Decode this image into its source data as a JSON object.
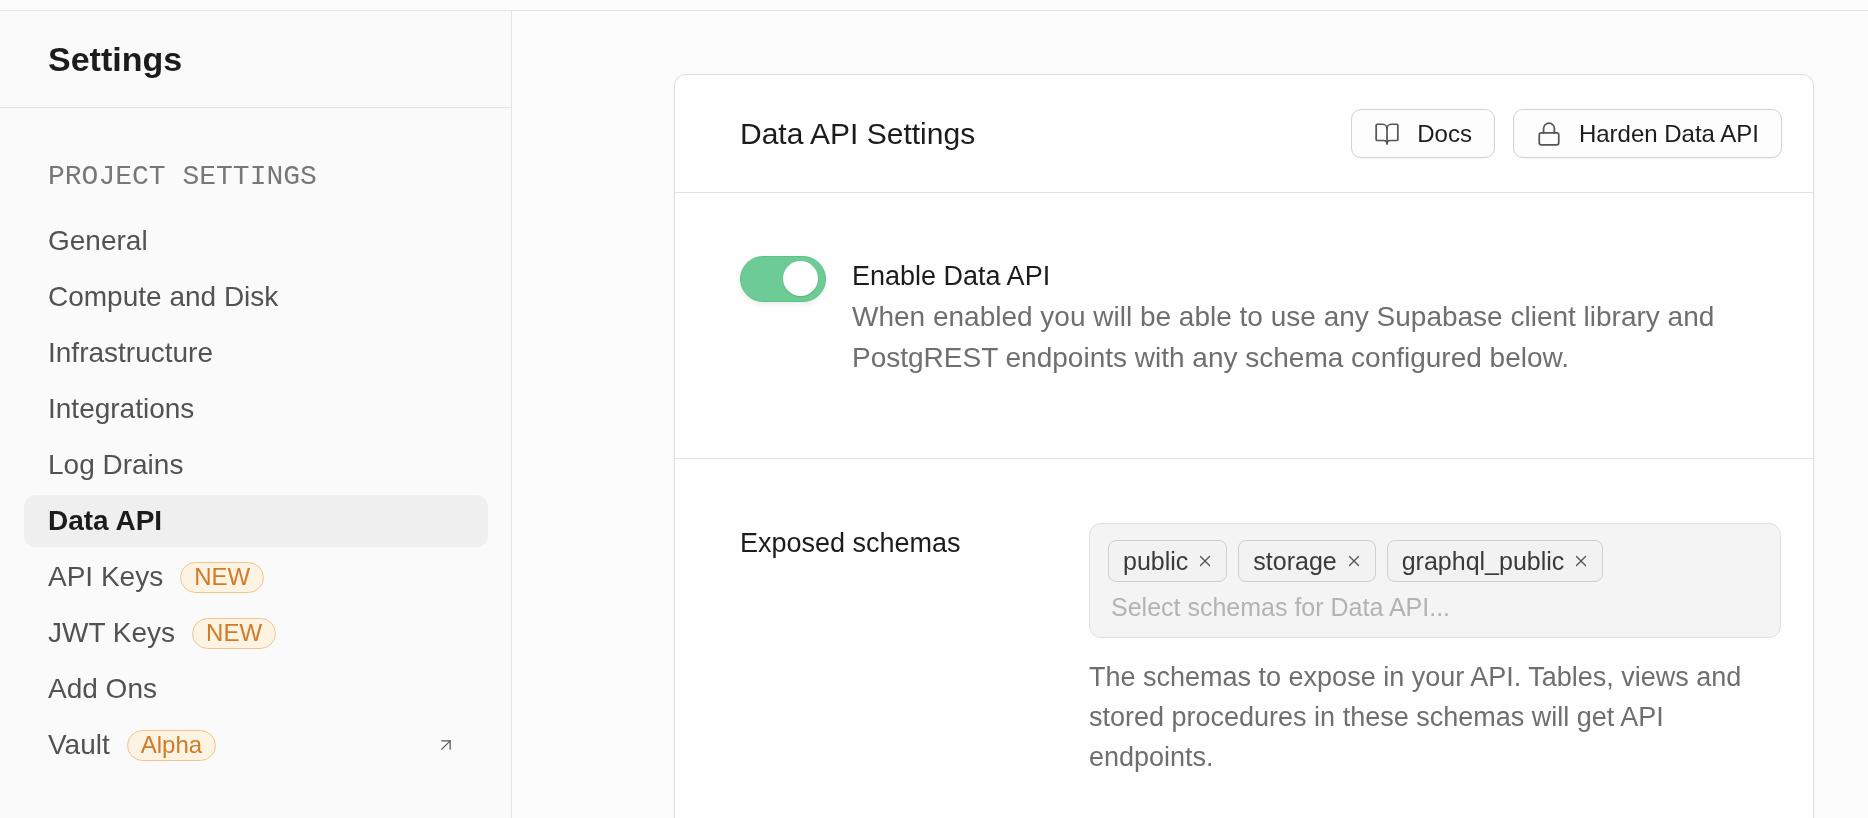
{
  "sidebar": {
    "title": "Settings",
    "section_label": "PROJECT SETTINGS",
    "items": [
      {
        "label": "General",
        "selected": false,
        "external": false
      },
      {
        "label": "Compute and Disk",
        "selected": false,
        "external": false
      },
      {
        "label": "Infrastructure",
        "selected": false,
        "external": false
      },
      {
        "label": "Integrations",
        "selected": false,
        "external": false
      },
      {
        "label": "Log Drains",
        "selected": false,
        "external": false
      },
      {
        "label": "Data API",
        "selected": true,
        "external": false
      },
      {
        "label": "API Keys",
        "selected": false,
        "external": false,
        "badge": "NEW"
      },
      {
        "label": "JWT Keys",
        "selected": false,
        "external": false,
        "badge": "NEW"
      },
      {
        "label": "Add Ons",
        "selected": false,
        "external": false
      },
      {
        "label": "Vault",
        "selected": false,
        "external": true,
        "badge": "Alpha"
      }
    ]
  },
  "card": {
    "title": "Data API Settings",
    "buttons": [
      {
        "kind": "docs",
        "label": "Docs"
      },
      {
        "kind": "harden",
        "label": "Harden Data API"
      }
    ],
    "api_toggle": {
      "label": "Enable Data API",
      "description": "When enabled you will be able to use any Supabase client library and PostgREST endpoints with any schema configured below.",
      "on": true
    },
    "exposed_schemas": {
      "label": "Exposed schemas",
      "chips": [
        "public",
        "storage",
        "graphql_public"
      ],
      "placeholder": "Select schemas for Data API...",
      "help": "The schemas to expose in your API. Tables, views and stored procedures in these schemas will get API endpoints."
    }
  }
}
